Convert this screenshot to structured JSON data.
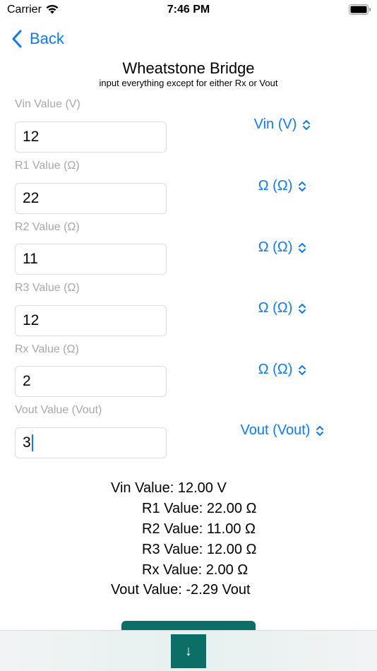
{
  "status_bar": {
    "carrier": "Carrier",
    "time": "7:46 PM"
  },
  "nav": {
    "back_label": "Back"
  },
  "header": {
    "title": "Wheatstone Bridge",
    "subtitle": "input everything except for either Rx or Vout"
  },
  "fields": [
    {
      "label": "Vin Value (V)",
      "value": "12",
      "unit": "Vin (V)"
    },
    {
      "label": "R1 Value (Ω)",
      "value": "22",
      "unit": "Ω (Ω)"
    },
    {
      "label": "R2 Value (Ω)",
      "value": "11",
      "unit": "Ω (Ω)"
    },
    {
      "label": "R3 Value (Ω)",
      "value": "12",
      "unit": "Ω (Ω)"
    },
    {
      "label": "Rx Value (Ω)",
      "value": "2",
      "unit": "Ω (Ω)"
    },
    {
      "label": "Vout Value (Vout)",
      "value": "3",
      "unit": "Vout (Vout)"
    }
  ],
  "results": [
    "Vin Value: 12.00 V",
    "R1 Value: 22.00 Ω",
    "R2 Value: 11.00 Ω",
    "R3 Value: 12.00 Ω",
    "Rx Value: 2.00 Ω",
    "Vout Value: -2.29 Vout"
  ],
  "bottom": {
    "scroll_icon": "↓"
  },
  "colors": {
    "accent": "#0a7aff",
    "button": "#0c6f67",
    "label_gray": "#a7a7ab"
  }
}
